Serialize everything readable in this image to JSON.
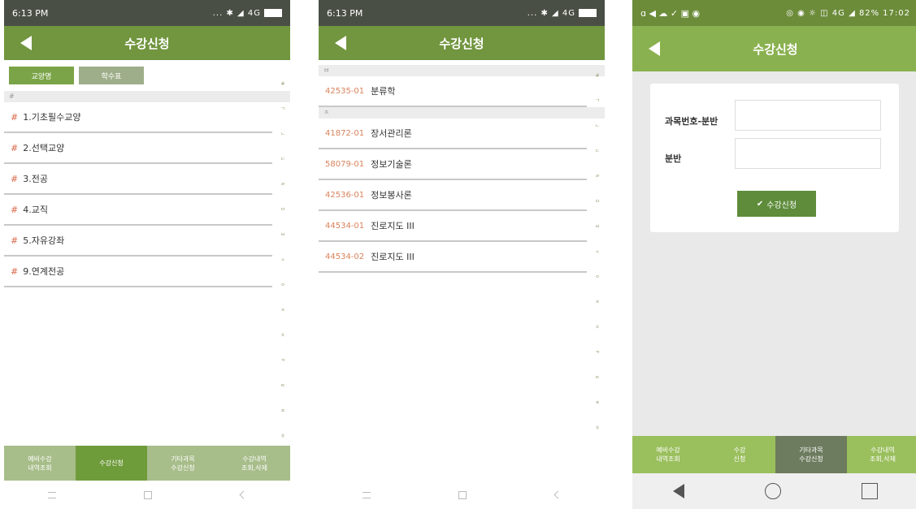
{
  "screen1": {
    "status": {
      "time": "6:13 PM",
      "icons": "... ✱ ◢ 4G"
    },
    "title": "수강신청",
    "tabs": [
      "교양명",
      "학수표"
    ],
    "section_header": "#",
    "items": [
      "1.기초필수교양",
      "2.선택교양",
      "3.전공",
      "4.교직",
      "5.자유강좌",
      "9.연계전공"
    ],
    "index_letters": [
      "#",
      "ㄱ",
      "ㄴ",
      "ㄷ",
      "ㄹ",
      "ㅁ",
      "ㅂ",
      "ㅅ",
      "ㅇ",
      "ㅈ",
      "ㅊ",
      "ㅋ",
      "ㅌ",
      "ㅍ",
      "ㅎ"
    ],
    "bottom_nav": [
      "예비수강\n내역조회",
      "수강신청",
      "기타과목\n수강신청",
      "수강내역\n조회,삭제"
    ]
  },
  "screen2": {
    "status": {
      "time": "6:13 PM",
      "icons": "... ✱ ◢ 4G"
    },
    "title": "수강신청",
    "sections": [
      {
        "header": "ㅂ",
        "rows": [
          {
            "code": "42535-01",
            "name": "분류학"
          }
        ]
      },
      {
        "header": "ㅈ",
        "rows": [
          {
            "code": "41872-01",
            "name": "장서관리론"
          },
          {
            "code": "58079-01",
            "name": "정보기술론"
          },
          {
            "code": "42536-01",
            "name": "정보봉사론"
          },
          {
            "code": "44534-01",
            "name": "진로지도 III"
          },
          {
            "code": "44534-02",
            "name": "진로지도 III"
          }
        ]
      }
    ]
  },
  "screen3": {
    "status": {
      "left": "ɑ ◀ ☁ ✓ ▣ ◉",
      "right": "◎ ◉ ☼ ◫ 4G ◢ 82%",
      "time": "17:02"
    },
    "title": "수강신청",
    "form": {
      "label_code": "과목번호-분반",
      "label_section": "분반",
      "submit": "수강신청"
    },
    "bottom_nav": [
      "예비수강\n내역조회",
      "수강\n신청",
      "기타과목\n수강신청",
      "수강내역\n조회,삭제"
    ]
  },
  "colors": {
    "title_green": "#71963f",
    "accent_green": "#8ab14f",
    "code_orange": "#d9825a"
  }
}
